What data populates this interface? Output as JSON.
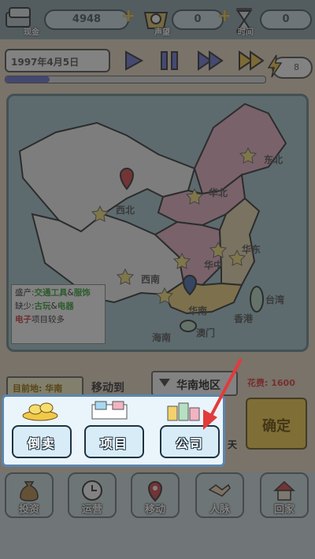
{
  "resources": {
    "cash": {
      "label": "现金",
      "value": "4948"
    },
    "reputation": {
      "label": "声望",
      "value": "0"
    },
    "time": {
      "label": "时间",
      "value": "0"
    }
  },
  "date": "1997年4月5日",
  "progress": 0.17,
  "speed_level": "8",
  "map": {
    "regions": [
      "东北",
      "华北",
      "西北",
      "华东",
      "华中",
      "西南",
      "华南",
      "台湾",
      "香港",
      "澳门",
      "海南"
    ],
    "legend": {
      "produce_label": "盛产:",
      "produce_items": [
        "交通工具",
        "服饰"
      ],
      "lack_label": "缺少:",
      "lack_items": [
        "古玩",
        "电器"
      ],
      "note_highlight": "电子",
      "note_rest": "项目较多"
    }
  },
  "move": {
    "current_location": "目前地: 华南",
    "move_to_label": "移动到",
    "destination": "华南地区",
    "cost_text": "花费: 1600",
    "confirm_label": "确定",
    "day_label": "天"
  },
  "popup": {
    "buttons": [
      {
        "label": "倒卖",
        "icon": "coins-icon"
      },
      {
        "label": "项目",
        "icon": "project-icon"
      },
      {
        "label": "公司",
        "icon": "company-icon"
      }
    ]
  },
  "nav": [
    {
      "label": "投资",
      "icon": "money-bag-icon"
    },
    {
      "label": "运营",
      "icon": "clock-icon"
    },
    {
      "label": "移动",
      "icon": "location-pin-icon"
    },
    {
      "label": "人脉",
      "icon": "handshake-icon"
    },
    {
      "label": "回家",
      "icon": "house-icon"
    }
  ],
  "colors": {
    "accent": "#f7d04a",
    "highlight_red": "#e23b3b",
    "map_water": "#a7c9d2"
  }
}
